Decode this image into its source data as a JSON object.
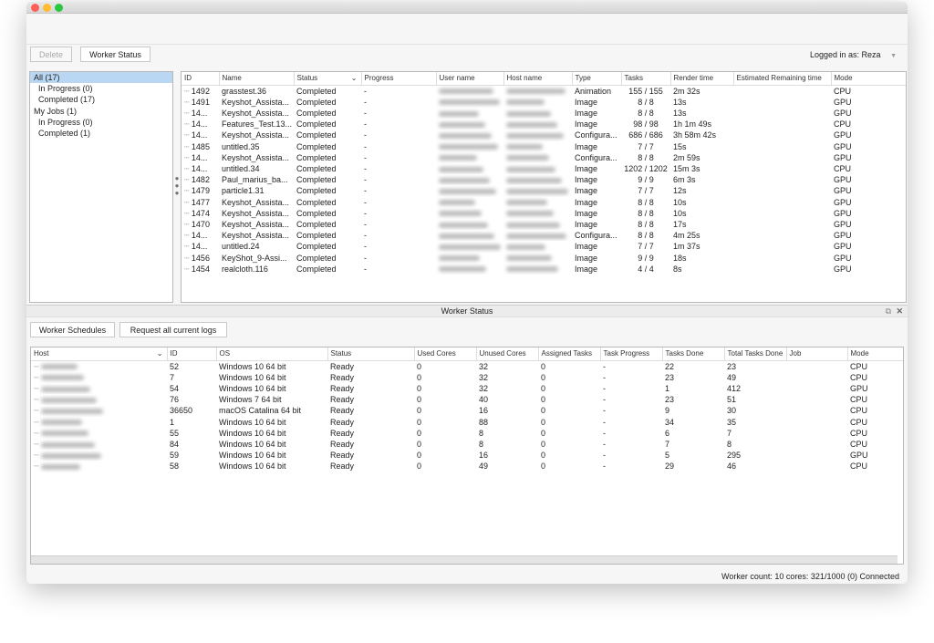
{
  "toolbar": {
    "delete_label": "Delete",
    "worker_status_label": "Worker Status",
    "logged_in": "Logged in as: Reza"
  },
  "sidebar": {
    "items": [
      {
        "label": "All (17)",
        "indent": false,
        "selected": true
      },
      {
        "label": "In Progress (0)",
        "indent": true
      },
      {
        "label": "Completed (17)",
        "indent": true
      },
      {
        "label": "My Jobs (1)",
        "indent": false
      },
      {
        "label": "In Progress (0)",
        "indent": true
      },
      {
        "label": "Completed (1)",
        "indent": true
      }
    ]
  },
  "jobs": {
    "columns": [
      "ID",
      "Name",
      "Status",
      "Progress",
      "User name",
      "Host name",
      "Type",
      "Tasks",
      "Render time",
      "Estimated Remaining time",
      "Mode"
    ],
    "rows": [
      [
        "1492",
        "grasstest.36",
        "Completed",
        "-",
        "",
        "",
        "Animation",
        "155 / 155",
        "2m 32s",
        "",
        "CPU"
      ],
      [
        "1491",
        "Keyshot_Assista...",
        "Completed",
        "-",
        "",
        "",
        "Image",
        "8 / 8",
        "13s",
        "",
        "GPU"
      ],
      [
        "14...",
        "Keyshot_Assista...",
        "Completed",
        "-",
        "",
        "",
        "Image",
        "8 / 8",
        "13s",
        "",
        "GPU"
      ],
      [
        "14...",
        "Features_Test.13...",
        "Completed",
        "-",
        "",
        "",
        "Image",
        "98 / 98",
        "1h 1m 49s",
        "",
        "CPU"
      ],
      [
        "14...",
        "Keyshot_Assista...",
        "Completed",
        "-",
        "",
        "",
        "Configura...",
        "686 / 686",
        "3h 58m 42s",
        "",
        "GPU"
      ],
      [
        "1485",
        "untitled.35",
        "Completed",
        "-",
        "",
        "",
        "Image",
        "7 / 7",
        "15s",
        "",
        "GPU"
      ],
      [
        "14...",
        "Keyshot_Assista...",
        "Completed",
        "-",
        "",
        "",
        "Configura...",
        "8 / 8",
        "2m 59s",
        "",
        "GPU"
      ],
      [
        "14...",
        "untitled.34",
        "Completed",
        "-",
        "",
        "",
        "Image",
        "1202 / 1202",
        "15m 3s",
        "",
        "CPU"
      ],
      [
        "1482",
        "Paul_marius_ba...",
        "Completed",
        "-",
        "",
        "",
        "Image",
        "9 / 9",
        "6m 3s",
        "",
        "GPU"
      ],
      [
        "1479",
        "particle1.31",
        "Completed",
        "-",
        "",
        "",
        "Image",
        "7 / 7",
        "12s",
        "",
        "GPU"
      ],
      [
        "1477",
        "Keyshot_Assista...",
        "Completed",
        "-",
        "",
        "",
        "Image",
        "8 / 8",
        "10s",
        "",
        "GPU"
      ],
      [
        "1474",
        "Keyshot_Assista...",
        "Completed",
        "-",
        "",
        "",
        "Image",
        "8 / 8",
        "10s",
        "",
        "GPU"
      ],
      [
        "1470",
        "Keyshot_Assista...",
        "Completed",
        "-",
        "",
        "",
        "Image",
        "8 / 8",
        "17s",
        "",
        "GPU"
      ],
      [
        "14...",
        "Keyshot_Assista...",
        "Completed",
        "-",
        "",
        "",
        "Configura...",
        "8 / 8",
        "4m 25s",
        "",
        "GPU"
      ],
      [
        "14...",
        "untitled.24",
        "Completed",
        "-",
        "",
        "",
        "Image",
        "7 / 7",
        "1m 37s",
        "",
        "GPU"
      ],
      [
        "1456",
        "KeyShot_9-Assi...",
        "Completed",
        "-",
        "",
        "",
        "Image",
        "9 / 9",
        "18s",
        "",
        "GPU"
      ],
      [
        "1454",
        "realcloth.116",
        "Completed",
        "-",
        "",
        "",
        "Image",
        "4 / 4",
        "8s",
        "",
        "GPU"
      ]
    ]
  },
  "worker_panel": {
    "title": "Worker Status",
    "schedules_label": "Worker Schedules",
    "logs_label": "Request all current logs"
  },
  "workers": {
    "columns": [
      "Host",
      "ID",
      "OS",
      "Status",
      "Used Cores",
      "Unused Cores",
      "Assigned Tasks",
      "Task Progress",
      "Tasks Done",
      "Total Tasks Done",
      "Job",
      "Mode"
    ],
    "rows": [
      [
        "",
        "52",
        "Windows 10 64 bit",
        "Ready",
        "0",
        "32",
        "0",
        "-",
        "22",
        "23",
        "",
        "CPU"
      ],
      [
        "",
        "7",
        "Windows 10 64 bit",
        "Ready",
        "0",
        "32",
        "0",
        "-",
        "23",
        "49",
        "",
        "CPU"
      ],
      [
        "",
        "54",
        "Windows 10 64 bit",
        "Ready",
        "0",
        "32",
        "0",
        "-",
        "1",
        "412",
        "",
        "GPU"
      ],
      [
        "",
        "76",
        "Windows 7 64 bit",
        "Ready",
        "0",
        "40",
        "0",
        "-",
        "23",
        "51",
        "",
        "CPU"
      ],
      [
        "",
        "36650",
        "macOS Catalina 64 bit",
        "Ready",
        "0",
        "16",
        "0",
        "-",
        "9",
        "30",
        "",
        "CPU"
      ],
      [
        "",
        "1",
        "Windows 10 64 bit",
        "Ready",
        "0",
        "88",
        "0",
        "-",
        "34",
        "35",
        "",
        "CPU"
      ],
      [
        "",
        "55",
        "Windows 10 64 bit",
        "Ready",
        "0",
        "8",
        "0",
        "-",
        "6",
        "7",
        "",
        "CPU"
      ],
      [
        "",
        "84",
        "Windows 10 64 bit",
        "Ready",
        "0",
        "8",
        "0",
        "-",
        "7",
        "8",
        "",
        "CPU"
      ],
      [
        "",
        "59",
        "Windows 10 64 bit",
        "Ready",
        "0",
        "16",
        "0",
        "-",
        "5",
        "295",
        "",
        "GPU"
      ],
      [
        "",
        "58",
        "Windows 10 64 bit",
        "Ready",
        "0",
        "49",
        "0",
        "-",
        "29",
        "46",
        "",
        "CPU"
      ]
    ]
  },
  "statusbar": {
    "text": "Worker count: 10  cores: 321/1000 (0)  Connected"
  }
}
